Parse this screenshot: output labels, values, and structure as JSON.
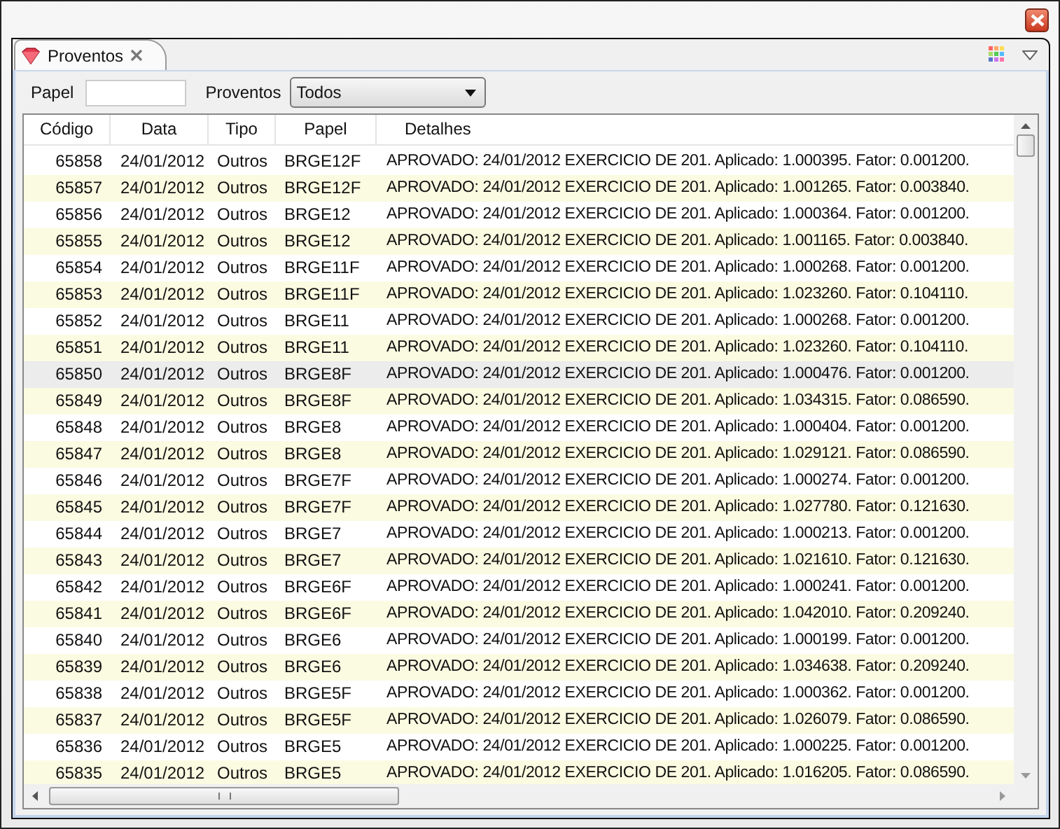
{
  "view": {
    "tab": {
      "label": "Proventos",
      "selected": true
    }
  },
  "filters": {
    "papel_label": "Papel",
    "proventos_label": "Proventos",
    "proventos_value": "Todos"
  },
  "table": {
    "columns": [
      "Código",
      "Data",
      "Tipo",
      "Papel",
      "Detalhes"
    ],
    "rows": [
      {
        "codigo": "65858",
        "data": "24/01/2012",
        "tipo": "Outros",
        "papel": "BRGE12F",
        "detalhes": "APROVADO: 24/01/2012 EXERCICIO DE 201. Aplicado: 1.000395. Fator: 0.001200.",
        "selected": false
      },
      {
        "codigo": "65857",
        "data": "24/01/2012",
        "tipo": "Outros",
        "papel": "BRGE12F",
        "detalhes": "APROVADO: 24/01/2012 EXERCICIO DE 201. Aplicado: 1.001265. Fator: 0.003840.",
        "selected": false
      },
      {
        "codigo": "65856",
        "data": "24/01/2012",
        "tipo": "Outros",
        "papel": "BRGE12",
        "detalhes": "APROVADO: 24/01/2012 EXERCICIO DE 201. Aplicado: 1.000364. Fator: 0.001200.",
        "selected": false
      },
      {
        "codigo": "65855",
        "data": "24/01/2012",
        "tipo": "Outros",
        "papel": "BRGE12",
        "detalhes": "APROVADO: 24/01/2012 EXERCICIO DE 201. Aplicado: 1.001165. Fator: 0.003840.",
        "selected": false
      },
      {
        "codigo": "65854",
        "data": "24/01/2012",
        "tipo": "Outros",
        "papel": "BRGE11F",
        "detalhes": "APROVADO: 24/01/2012 EXERCICIO DE 201. Aplicado: 1.000268. Fator: 0.001200.",
        "selected": false
      },
      {
        "codigo": "65853",
        "data": "24/01/2012",
        "tipo": "Outros",
        "papel": "BRGE11F",
        "detalhes": "APROVADO: 24/01/2012 EXERCICIO DE 201. Aplicado: 1.023260. Fator: 0.104110.",
        "selected": false
      },
      {
        "codigo": "65852",
        "data": "24/01/2012",
        "tipo": "Outros",
        "papel": "BRGE11",
        "detalhes": "APROVADO: 24/01/2012 EXERCICIO DE 201. Aplicado: 1.000268. Fator: 0.001200.",
        "selected": false
      },
      {
        "codigo": "65851",
        "data": "24/01/2012",
        "tipo": "Outros",
        "papel": "BRGE11",
        "detalhes": "APROVADO: 24/01/2012 EXERCICIO DE 201. Aplicado: 1.023260. Fator: 0.104110.",
        "selected": false
      },
      {
        "codigo": "65850",
        "data": "24/01/2012",
        "tipo": "Outros",
        "papel": "BRGE8F",
        "detalhes": "APROVADO: 24/01/2012 EXERCICIO DE 201. Aplicado: 1.000476. Fator: 0.001200.",
        "selected": true
      },
      {
        "codigo": "65849",
        "data": "24/01/2012",
        "tipo": "Outros",
        "papel": "BRGE8F",
        "detalhes": "APROVADO: 24/01/2012 EXERCICIO DE 201. Aplicado: 1.034315. Fator: 0.086590.",
        "selected": false
      },
      {
        "codigo": "65848",
        "data": "24/01/2012",
        "tipo": "Outros",
        "papel": "BRGE8",
        "detalhes": "APROVADO: 24/01/2012 EXERCICIO DE 201. Aplicado: 1.000404. Fator: 0.001200.",
        "selected": false
      },
      {
        "codigo": "65847",
        "data": "24/01/2012",
        "tipo": "Outros",
        "papel": "BRGE8",
        "detalhes": "APROVADO: 24/01/2012 EXERCICIO DE 201. Aplicado: 1.029121. Fator: 0.086590.",
        "selected": false
      },
      {
        "codigo": "65846",
        "data": "24/01/2012",
        "tipo": "Outros",
        "papel": "BRGE7F",
        "detalhes": "APROVADO: 24/01/2012 EXERCICIO DE 201. Aplicado: 1.000274. Fator: 0.001200.",
        "selected": false
      },
      {
        "codigo": "65845",
        "data": "24/01/2012",
        "tipo": "Outros",
        "papel": "BRGE7F",
        "detalhes": "APROVADO: 24/01/2012 EXERCICIO DE 201. Aplicado: 1.027780. Fator: 0.121630.",
        "selected": false
      },
      {
        "codigo": "65844",
        "data": "24/01/2012",
        "tipo": "Outros",
        "papel": "BRGE7",
        "detalhes": "APROVADO: 24/01/2012 EXERCICIO DE 201. Aplicado: 1.000213. Fator: 0.001200.",
        "selected": false
      },
      {
        "codigo": "65843",
        "data": "24/01/2012",
        "tipo": "Outros",
        "papel": "BRGE7",
        "detalhes": "APROVADO: 24/01/2012 EXERCICIO DE 201. Aplicado: 1.021610. Fator: 0.121630.",
        "selected": false
      },
      {
        "codigo": "65842",
        "data": "24/01/2012",
        "tipo": "Outros",
        "papel": "BRGE6F",
        "detalhes": "APROVADO: 24/01/2012 EXERCICIO DE 201. Aplicado: 1.000241. Fator: 0.001200.",
        "selected": false
      },
      {
        "codigo": "65841",
        "data": "24/01/2012",
        "tipo": "Outros",
        "papel": "BRGE6F",
        "detalhes": "APROVADO: 24/01/2012 EXERCICIO DE 201. Aplicado: 1.042010. Fator: 0.209240.",
        "selected": false
      },
      {
        "codigo": "65840",
        "data": "24/01/2012",
        "tipo": "Outros",
        "papel": "BRGE6",
        "detalhes": "APROVADO: 24/01/2012 EXERCICIO DE 201. Aplicado: 1.000199. Fator: 0.001200.",
        "selected": false
      },
      {
        "codigo": "65839",
        "data": "24/01/2012",
        "tipo": "Outros",
        "papel": "BRGE6",
        "detalhes": "APROVADO: 24/01/2012 EXERCICIO DE 201. Aplicado: 1.034638. Fator: 0.209240.",
        "selected": false
      },
      {
        "codigo": "65838",
        "data": "24/01/2012",
        "tipo": "Outros",
        "papel": "BRGE5F",
        "detalhes": "APROVADO: 24/01/2012 EXERCICIO DE 201. Aplicado: 1.000362. Fator: 0.001200.",
        "selected": false
      },
      {
        "codigo": "65837",
        "data": "24/01/2012",
        "tipo": "Outros",
        "papel": "BRGE5F",
        "detalhes": "APROVADO: 24/01/2012 EXERCICIO DE 201. Aplicado: 1.026079. Fator: 0.086590.",
        "selected": false
      },
      {
        "codigo": "65836",
        "data": "24/01/2012",
        "tipo": "Outros",
        "papel": "BRGE5",
        "detalhes": "APROVADO: 24/01/2012 EXERCICIO DE 201. Aplicado: 1.000225. Fator: 0.001200.",
        "selected": false
      },
      {
        "codigo": "65835",
        "data": "24/01/2012",
        "tipo": "Outros",
        "papel": "BRGE5",
        "detalhes": "APROVADO: 24/01/2012 EXERCICIO DE 201. Aplicado: 1.016205. Fator: 0.086590.",
        "selected": false
      }
    ]
  }
}
